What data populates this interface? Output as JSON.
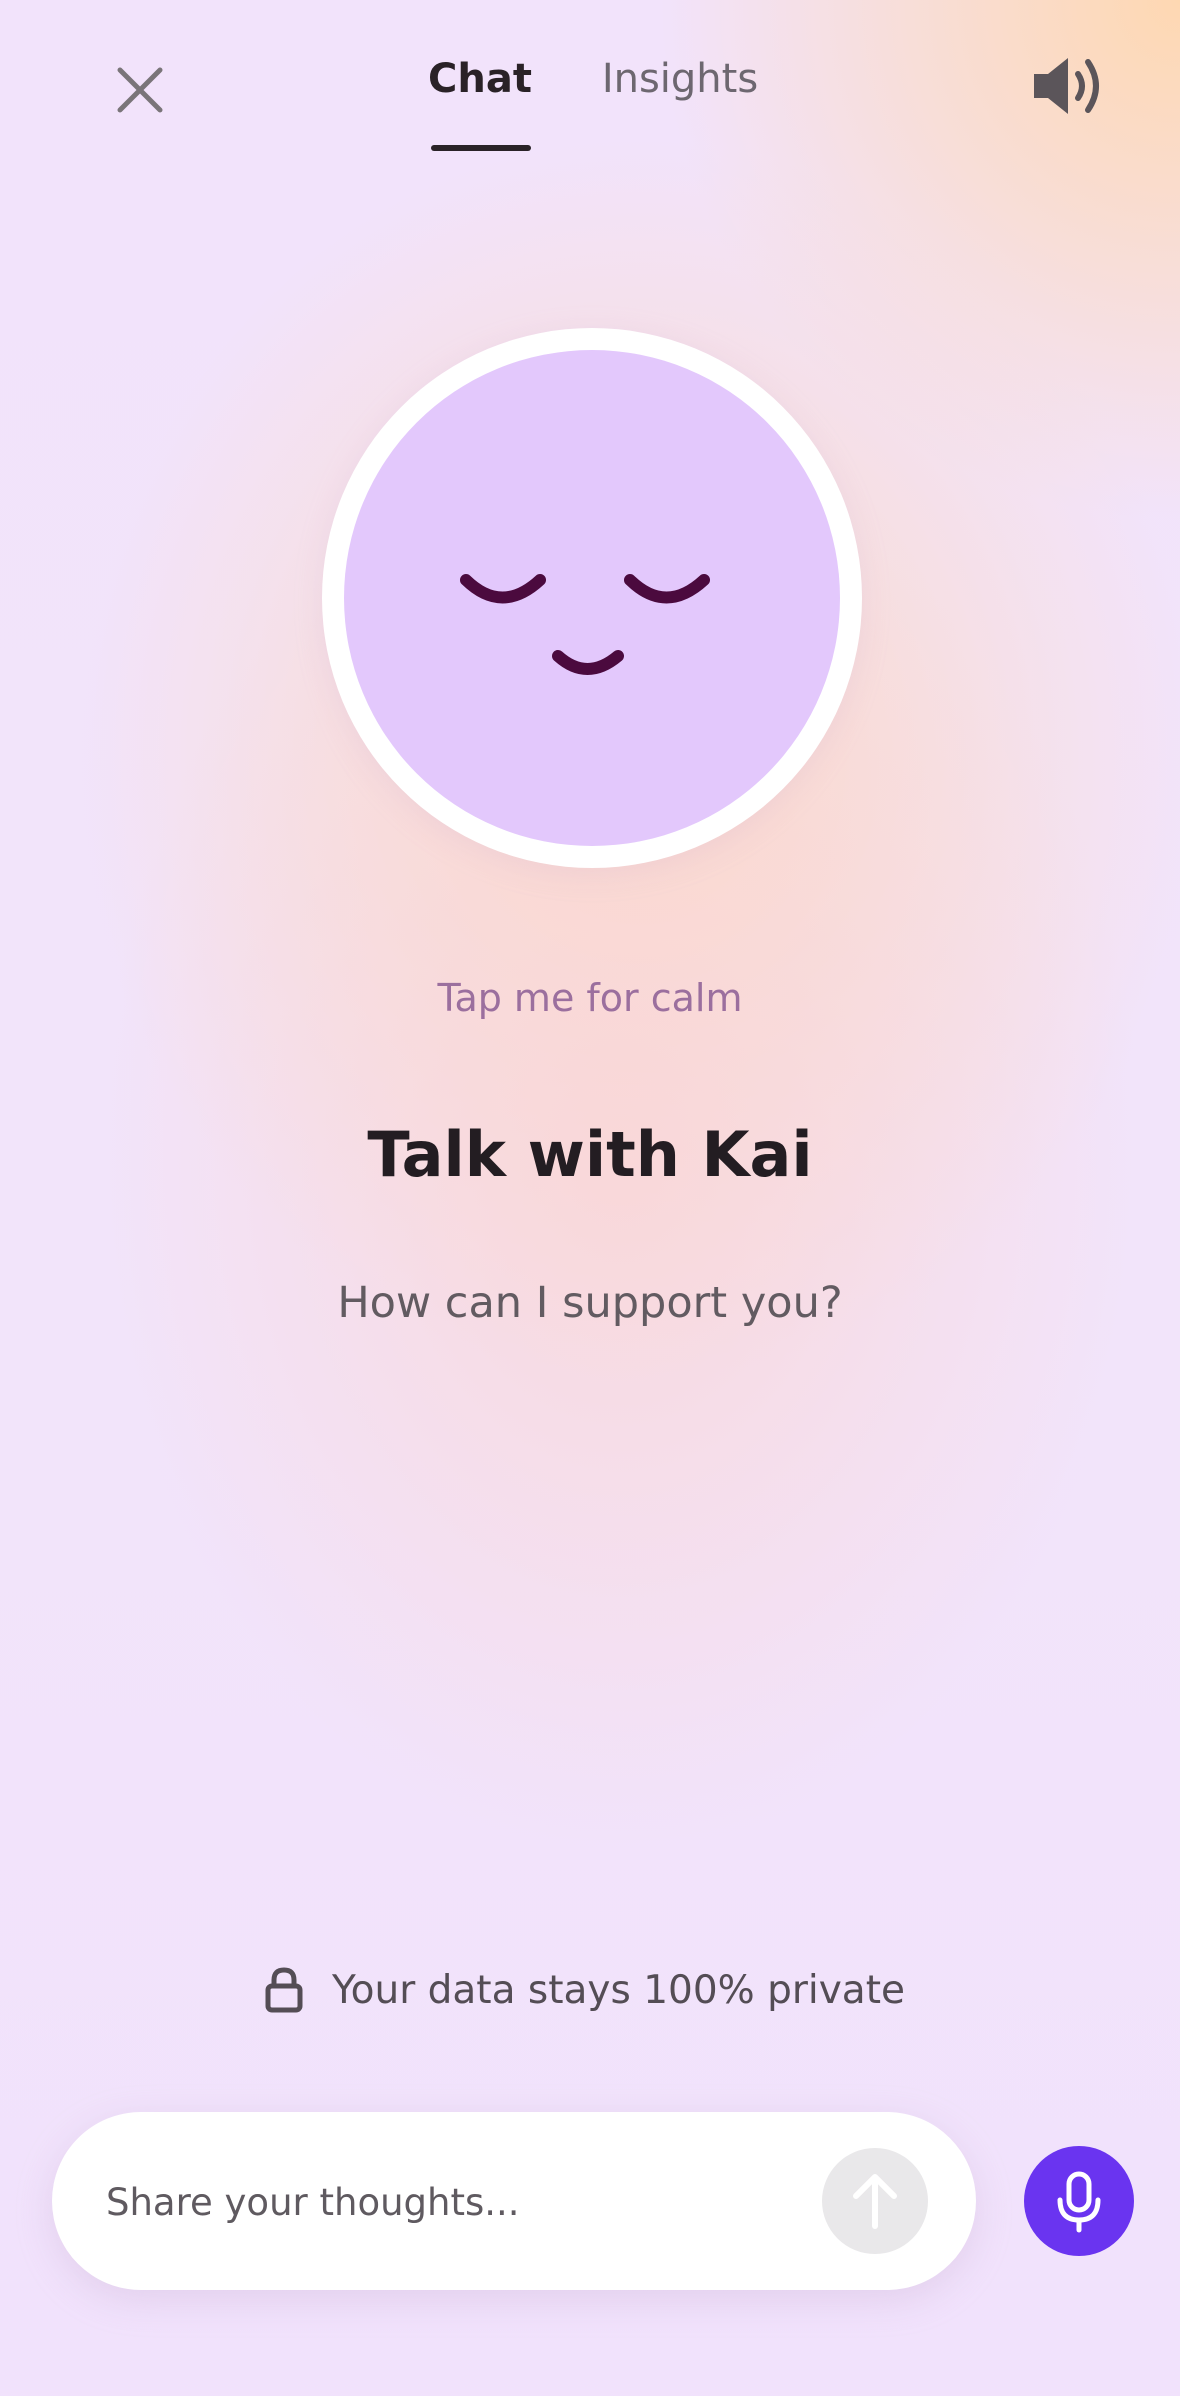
{
  "header": {
    "close_icon": "close-icon",
    "tabs": [
      {
        "label": "Chat",
        "active": true
      },
      {
        "label": "Insights",
        "active": false
      }
    ],
    "sound_icon": "speaker-icon"
  },
  "avatar": {
    "icon": "calm-face-icon",
    "face_color": "#e3c8fc",
    "feature_color": "#4b0a3e"
  },
  "main": {
    "hint": "Tap me for calm",
    "title": "Talk with Kai",
    "subtitle": "How can I support you?"
  },
  "privacy": {
    "icon": "lock-icon",
    "text": "Your data stays 100% private"
  },
  "composer": {
    "placeholder": "Share your thoughts...",
    "value": "",
    "send_icon": "arrow-up-icon",
    "mic_icon": "microphone-icon",
    "mic_color": "#6a34f0"
  }
}
